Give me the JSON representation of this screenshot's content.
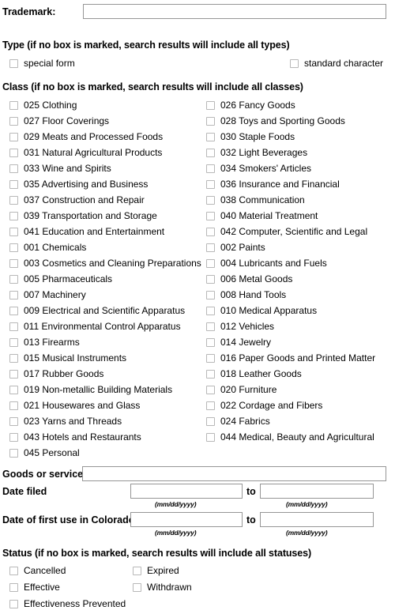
{
  "trademark": {
    "label": "Trademark:",
    "value": "",
    "placeholder": ""
  },
  "type": {
    "heading": "Type (if no box is marked, search results will include all types)",
    "options": [
      {
        "label": "special form",
        "checked": false
      },
      {
        "label": "standard character",
        "checked": false
      }
    ]
  },
  "classes": {
    "heading": "Class (if no box is marked, search results will include all classes)",
    "rows": [
      [
        {
          "label": "025 Clothing",
          "checked": false
        },
        {
          "label": "026 Fancy Goods",
          "checked": false
        }
      ],
      [
        {
          "label": "027 Floor Coverings",
          "checked": false
        },
        {
          "label": "028 Toys and Sporting Goods",
          "checked": false
        }
      ],
      [
        {
          "label": "029 Meats and Processed Foods",
          "checked": false
        },
        {
          "label": "030 Staple Foods",
          "checked": false
        }
      ],
      [
        {
          "label": "031 Natural Agricultural Products",
          "checked": false
        },
        {
          "label": "032 Light Beverages",
          "checked": false
        }
      ],
      [
        {
          "label": "033 Wine and Spirits",
          "checked": false
        },
        {
          "label": "034 Smokers' Articles",
          "checked": false
        }
      ],
      [
        {
          "label": "035 Advertising and Business",
          "checked": false
        },
        {
          "label": "036 Insurance and Financial",
          "checked": false
        }
      ],
      [
        {
          "label": "037 Construction and Repair",
          "checked": false
        },
        {
          "label": "038 Communication",
          "checked": false
        }
      ],
      [
        {
          "label": "039 Transportation and Storage",
          "checked": false
        },
        {
          "label": "040 Material Treatment",
          "checked": false
        }
      ],
      [
        {
          "label": "041 Education and Entertainment",
          "checked": false
        },
        {
          "label": "042 Computer, Scientific and Legal",
          "checked": false
        }
      ],
      [
        {
          "label": "001 Chemicals",
          "checked": false
        },
        {
          "label": "002 Paints",
          "checked": false
        }
      ],
      [
        {
          "label": "003 Cosmetics and Cleaning Preparations",
          "checked": false
        },
        {
          "label": "004 Lubricants and Fuels",
          "checked": false
        }
      ],
      [
        {
          "label": "005 Pharmaceuticals",
          "checked": false
        },
        {
          "label": "006 Metal Goods",
          "checked": false
        }
      ],
      [
        {
          "label": "007 Machinery",
          "checked": false
        },
        {
          "label": "008 Hand Tools",
          "checked": false
        }
      ],
      [
        {
          "label": "009 Electrical and Scientific Apparatus",
          "checked": false
        },
        {
          "label": "010 Medical Apparatus",
          "checked": false
        }
      ],
      [
        {
          "label": "011 Environmental Control Apparatus",
          "checked": false
        },
        {
          "label": "012 Vehicles",
          "checked": false
        }
      ],
      [
        {
          "label": "013 Firearms",
          "checked": false
        },
        {
          "label": "014 Jewelry",
          "checked": false
        }
      ],
      [
        {
          "label": "015 Musical Instruments",
          "checked": false
        },
        {
          "label": "016 Paper Goods and Printed Matter",
          "checked": false
        }
      ],
      [
        {
          "label": "017 Rubber Goods",
          "checked": false
        },
        {
          "label": "018 Leather Goods",
          "checked": false
        }
      ],
      [
        {
          "label": "019 Non-metallic Building Materials",
          "checked": false
        },
        {
          "label": "020 Furniture",
          "checked": false
        }
      ],
      [
        {
          "label": "021 Housewares and Glass",
          "checked": false
        },
        {
          "label": "022 Cordage and Fibers",
          "checked": false
        }
      ],
      [
        {
          "label": "023 Yarns and Threads",
          "checked": false
        },
        {
          "label": "024 Fabrics",
          "checked": false
        }
      ],
      [
        {
          "label": "043 Hotels and Restaurants",
          "checked": false
        },
        {
          "label": "044 Medical, Beauty and Agricultural",
          "checked": false
        }
      ],
      [
        {
          "label": "045 Personal",
          "checked": false
        }
      ]
    ]
  },
  "goods": {
    "label": "Goods or service:",
    "value": "",
    "placeholder": ""
  },
  "date_filed": {
    "label": "Date filed",
    "to_word": "to",
    "from_value": "",
    "to_value": "",
    "from_hint": "(mm/dd/yyyy)",
    "to_hint": "(mm/dd/yyyy)"
  },
  "date_first_use": {
    "label": "Date of first use in Colorado",
    "to_word": "to",
    "from_value": "",
    "to_value": "",
    "from_hint": "(mm/dd/yyyy)",
    "to_hint": "(mm/dd/yyyy)"
  },
  "status": {
    "heading": "Status (if no box is marked, search results will include all statuses)",
    "rows": [
      [
        {
          "label": "Cancelled",
          "checked": false
        },
        {
          "label": "Expired",
          "checked": false
        }
      ],
      [
        {
          "label": "Effective",
          "checked": false
        },
        {
          "label": "Withdrawn",
          "checked": false
        }
      ],
      [
        {
          "label": "Effectiveness Prevented",
          "checked": false
        }
      ]
    ]
  },
  "colors": {
    "input_border": "#969696",
    "checkbox_border": "#b8b8b8",
    "text": "#000000",
    "background": "#ffffff"
  }
}
